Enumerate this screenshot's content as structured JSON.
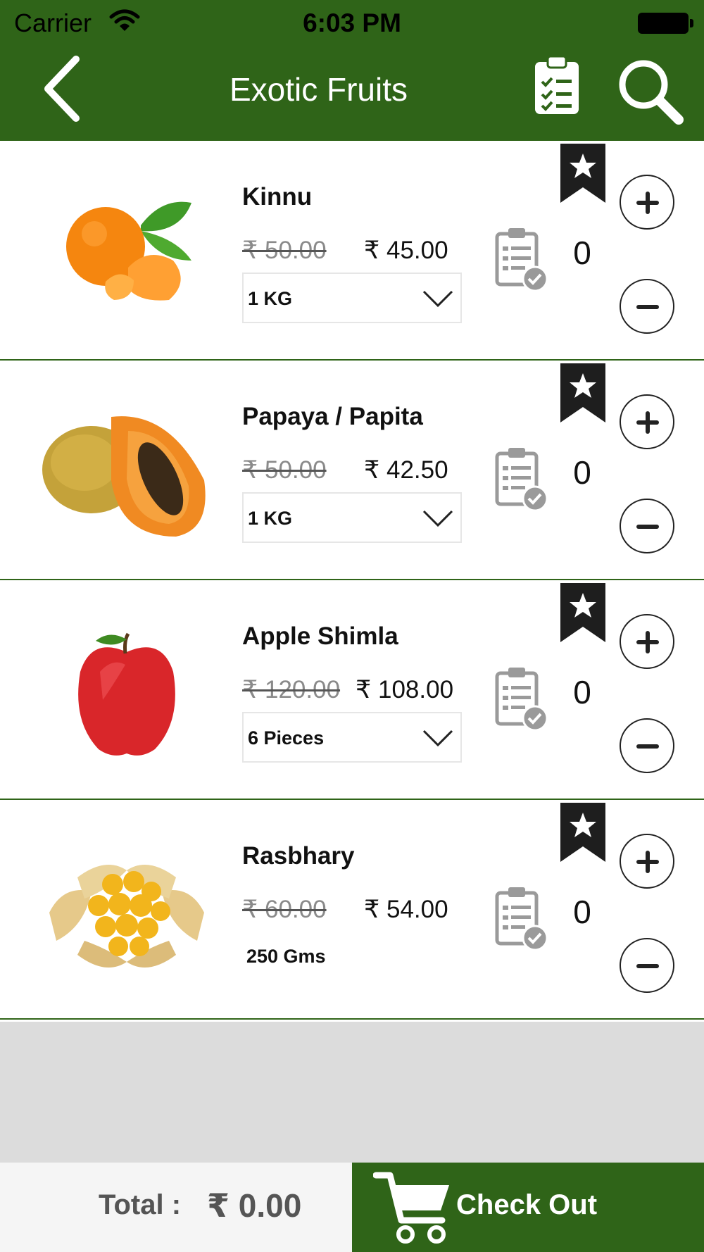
{
  "status_bar": {
    "carrier": "Carrier",
    "time": "6:03 PM"
  },
  "header": {
    "title": "Exotic Fruits"
  },
  "products": [
    {
      "name": "Kinnu",
      "old_price": "₹ 50.00",
      "price": "₹ 45.00",
      "unit": "1 KG",
      "quantity": "0"
    },
    {
      "name": "Papaya / Papita",
      "old_price": "₹ 50.00",
      "price": "₹ 42.50",
      "unit": "1 KG",
      "quantity": "0"
    },
    {
      "name": "Apple Shimla",
      "old_price": "₹ 120.00",
      "price": "₹ 108.00",
      "unit": "6 Pieces",
      "quantity": "0"
    },
    {
      "name": "Rasbhary",
      "old_price": "₹ 60.00",
      "price": "₹ 54.00",
      "unit": "250 Gms",
      "quantity": "0"
    }
  ],
  "footer": {
    "total_label": "Total :",
    "total_value": "₹ 0.00",
    "checkout_label": "Check Out"
  },
  "icons": {
    "back": "chevron-left-icon",
    "orders": "clipboard-checklist-icon",
    "search": "magnifier-icon",
    "favorite": "bookmark-star-icon",
    "note": "clipboard-check-icon",
    "cart": "shopping-cart-icon"
  },
  "colors": {
    "brand_green": "#2f6418",
    "filler_gray": "#dcdcdc",
    "footer_gray": "#f5f5f5"
  }
}
